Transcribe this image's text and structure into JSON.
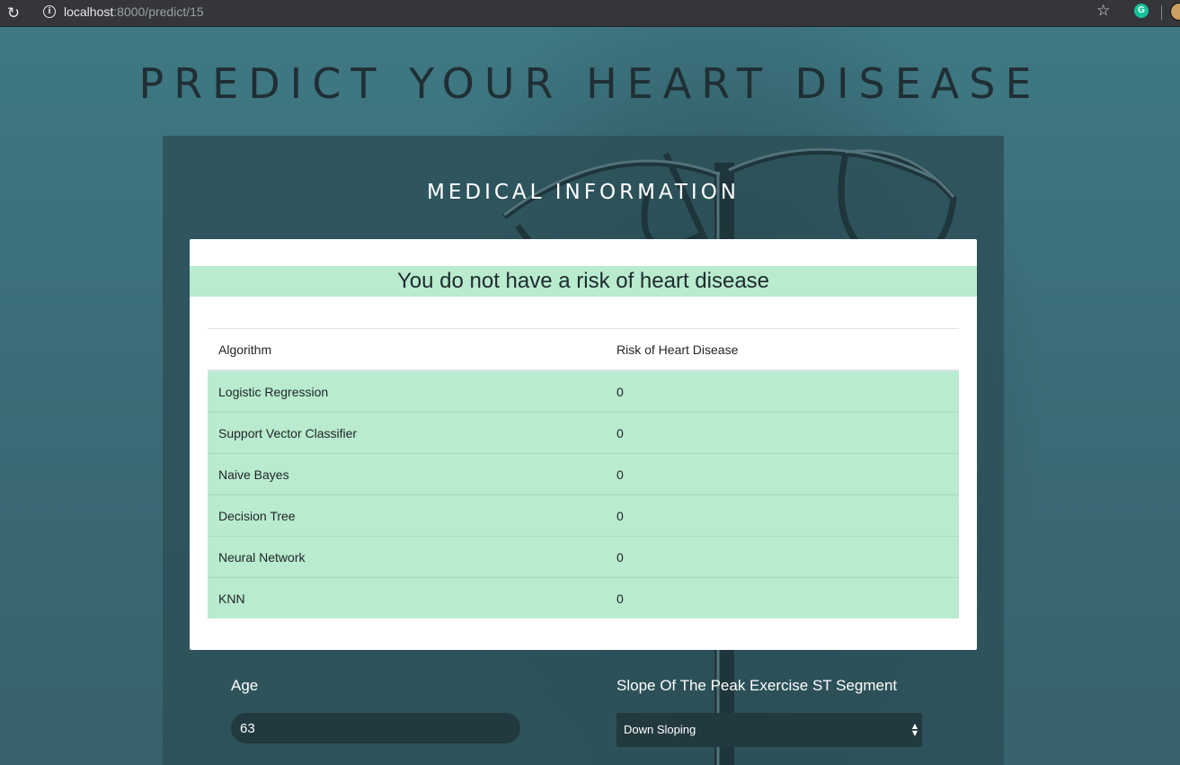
{
  "browser": {
    "url_host": "localhost",
    "url_path": ":8000/predict/15"
  },
  "page": {
    "title": "PREDICT YOUR HEART DISEASE",
    "section_title": "MEDICAL INFORMATION"
  },
  "result": {
    "message": "You do not have a risk of heart disease",
    "status_color": "#b9ebcf",
    "table": {
      "headers": [
        "Algorithm",
        "Risk of Heart Disease"
      ],
      "rows": [
        {
          "algorithm": "Logistic Regression",
          "risk": "0"
        },
        {
          "algorithm": "Support Vector Classifier",
          "risk": "0"
        },
        {
          "algorithm": "Naive Bayes",
          "risk": "0"
        },
        {
          "algorithm": "Decision Tree",
          "risk": "0"
        },
        {
          "algorithm": "Neural Network",
          "risk": "0"
        },
        {
          "algorithm": "KNN",
          "risk": "0"
        }
      ]
    }
  },
  "form": {
    "age_label": "Age",
    "age_value": "63",
    "slope_label": "Slope Of The Peak Exercise ST Segment",
    "slope_value": "Down Sloping"
  }
}
